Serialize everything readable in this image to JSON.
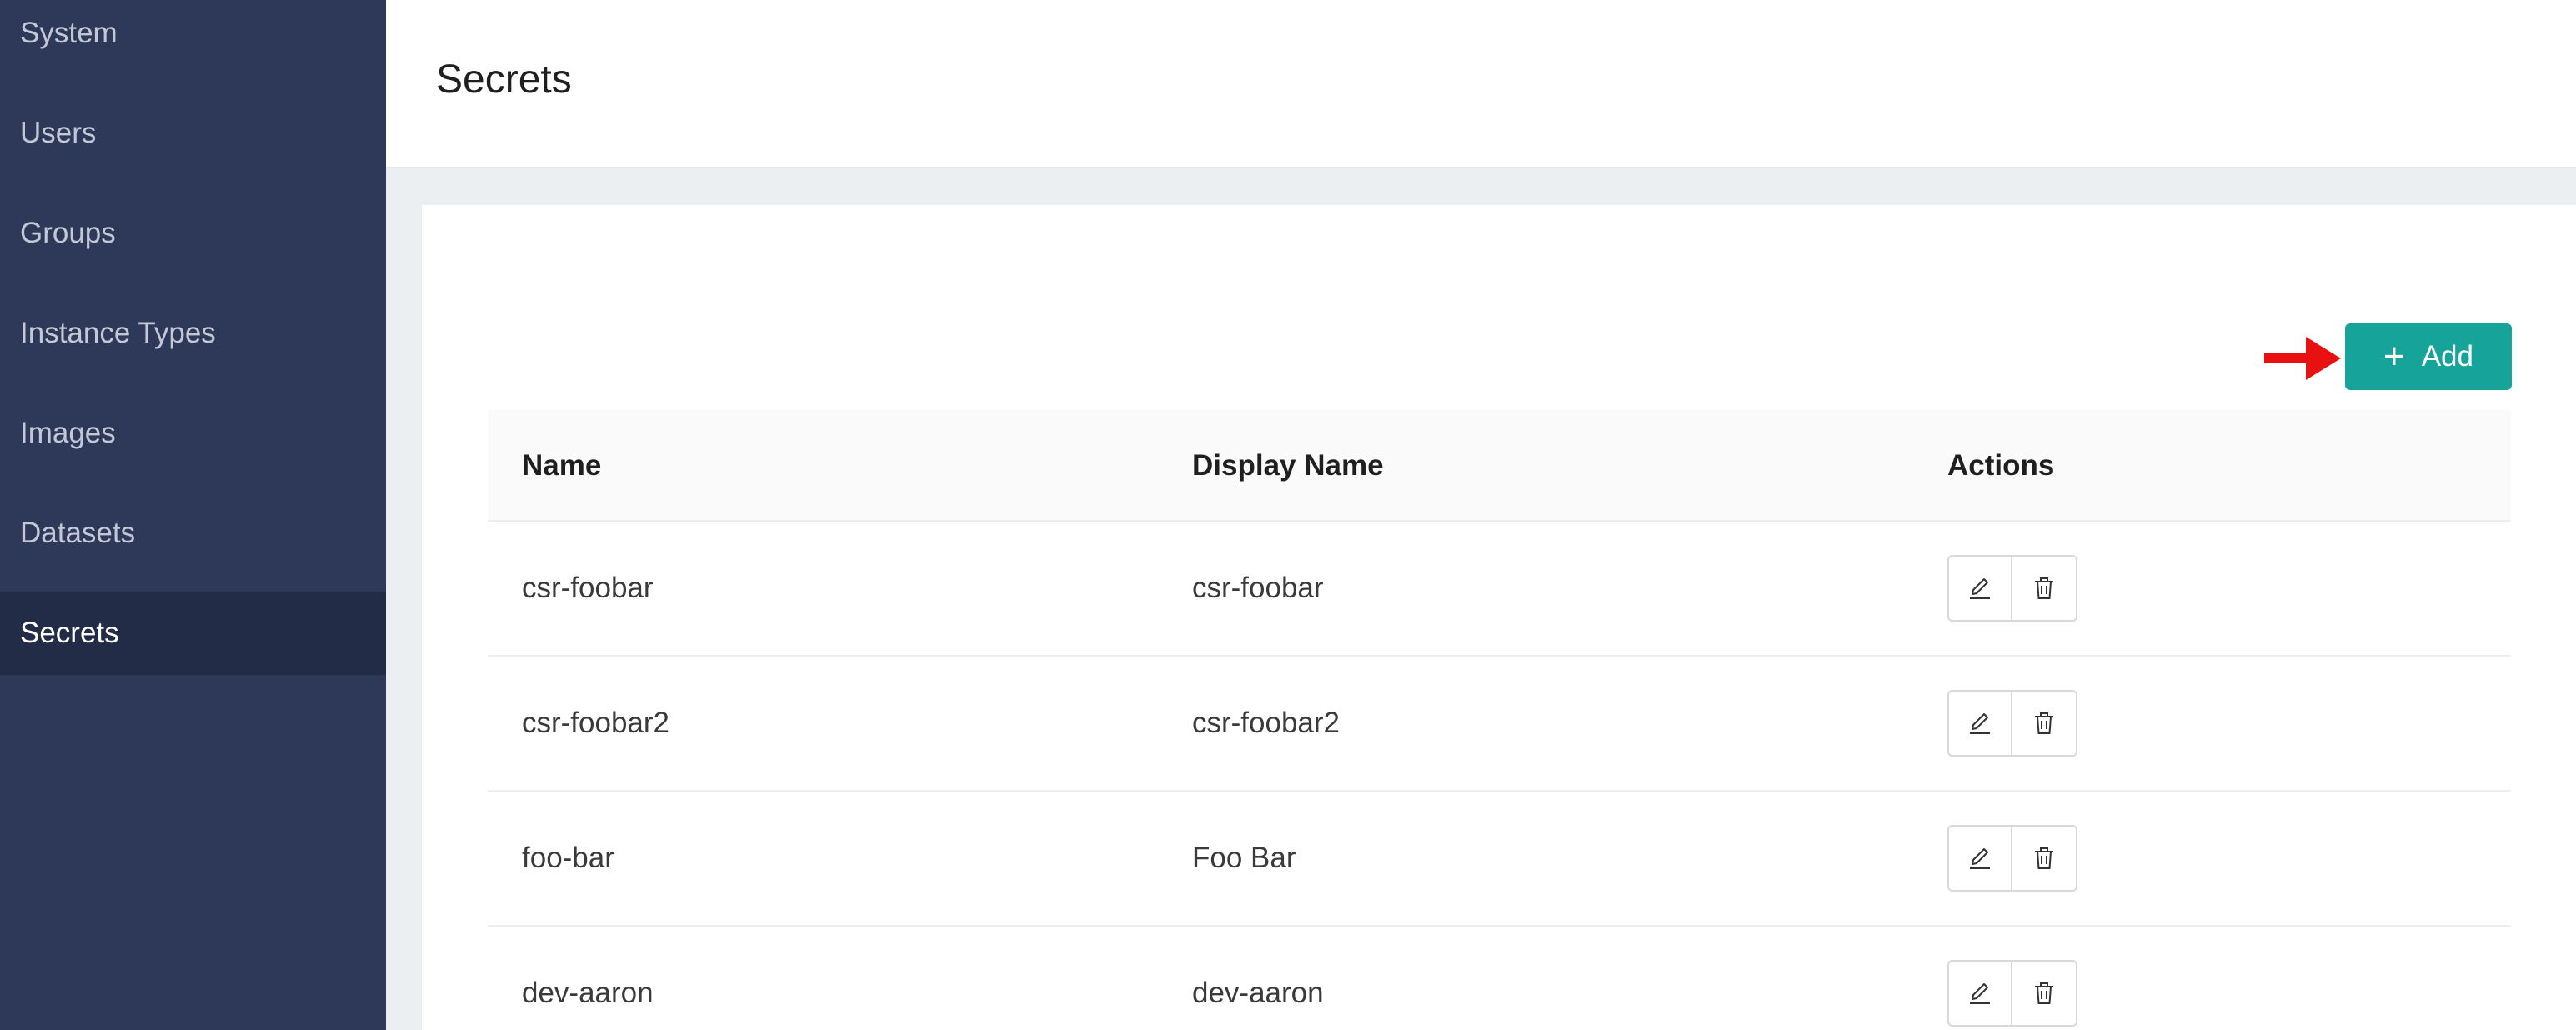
{
  "sidebar": {
    "items": [
      {
        "label": "System",
        "active": false
      },
      {
        "label": "Users",
        "active": false
      },
      {
        "label": "Groups",
        "active": false
      },
      {
        "label": "Instance Types",
        "active": false
      },
      {
        "label": "Images",
        "active": false
      },
      {
        "label": "Datasets",
        "active": false
      },
      {
        "label": "Secrets",
        "active": true
      }
    ]
  },
  "header": {
    "title": "Secrets"
  },
  "toolbar": {
    "add_label": "Add",
    "add_icon": "plus-icon",
    "arrow_icon": "red-arrow-icon",
    "accent": "#16a39a",
    "arrow_color": "#e81010"
  },
  "table": {
    "columns": [
      "Name",
      "Display Name",
      "Actions"
    ],
    "rows": [
      {
        "name": "csr-foobar",
        "display_name": "csr-foobar"
      },
      {
        "name": "csr-foobar2",
        "display_name": "csr-foobar2"
      },
      {
        "name": "foo-bar",
        "display_name": "Foo Bar"
      },
      {
        "name": "dev-aaron",
        "display_name": "dev-aaron"
      }
    ],
    "row_actions": [
      "edit-icon",
      "delete-icon"
    ]
  }
}
